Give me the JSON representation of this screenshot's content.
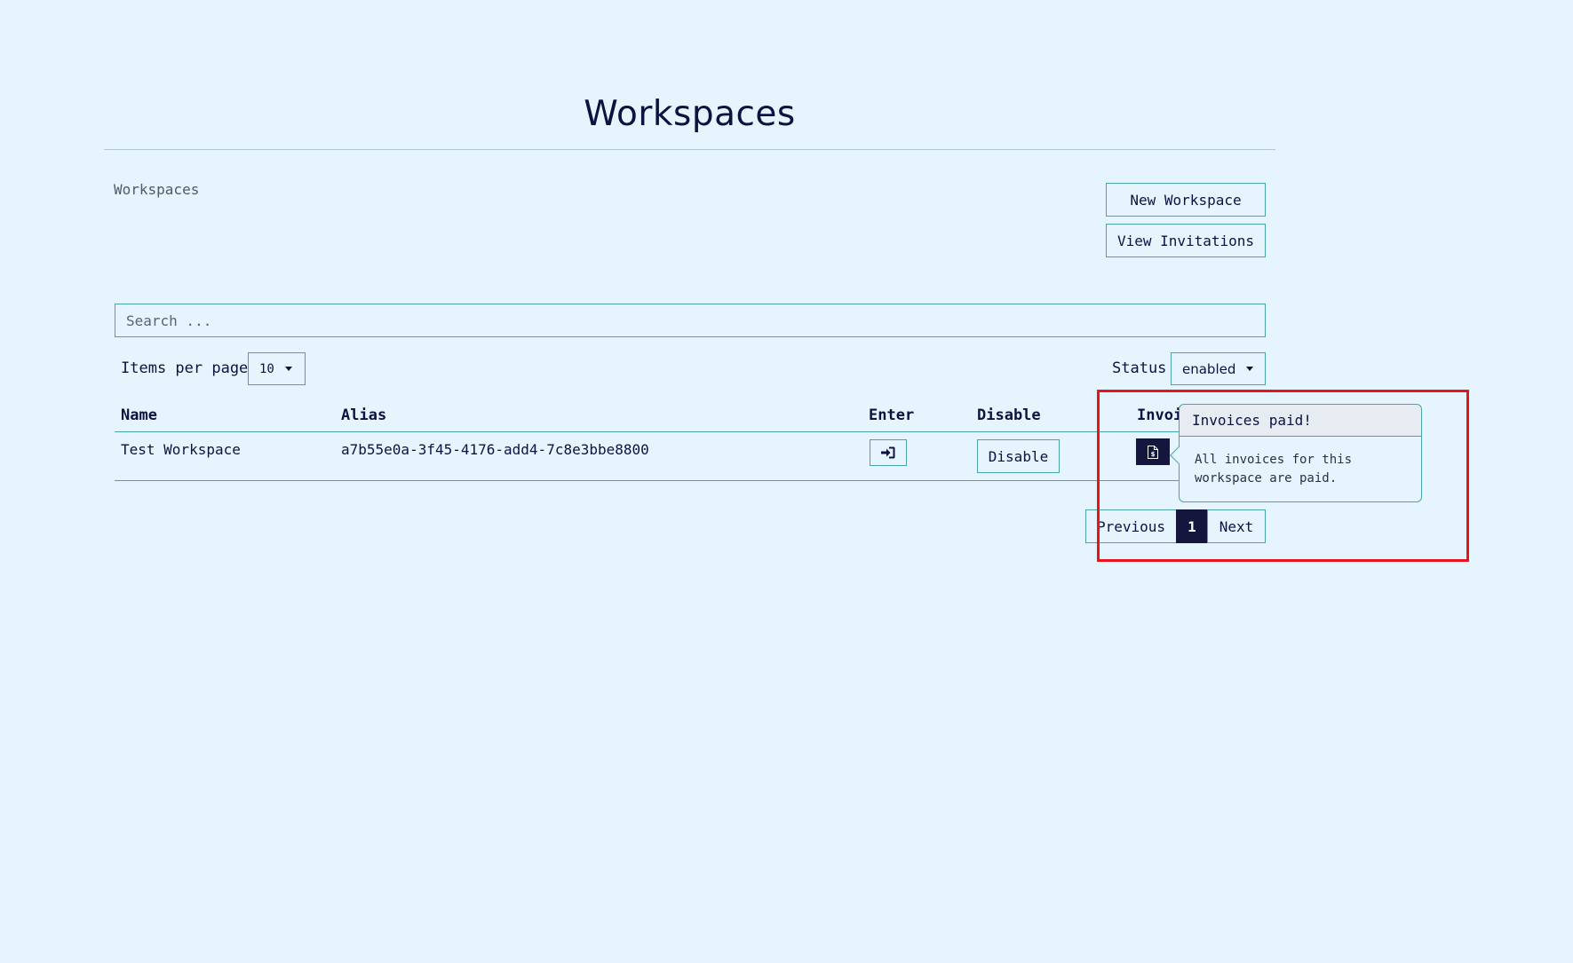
{
  "page": {
    "title": "Workspaces",
    "breadcrumb": "Workspaces"
  },
  "actions": {
    "new_workspace": "New Workspace",
    "view_invitations": "View Invitations"
  },
  "search": {
    "placeholder": "Search ...",
    "value": ""
  },
  "filters": {
    "items_per_page_label": "Items per page",
    "items_per_page_value": "10",
    "status_label": "Status",
    "status_value": "enabled"
  },
  "table": {
    "columns": [
      "Name",
      "Alias",
      "Enter",
      "Disable",
      "Invoices"
    ],
    "rows": [
      {
        "name": "Test Workspace",
        "alias": "a7b55e0a-3f45-4176-add4-7c8e3bbe8800",
        "enter_icon": "sign-in-icon",
        "disable_label": "Disable",
        "invoice_icon": "invoice-dollar-icon"
      }
    ]
  },
  "popover": {
    "title": "Invoices paid!",
    "body": "All invoices for this workspace are paid."
  },
  "pagination": {
    "previous": "Previous",
    "current": "1",
    "next": "Next"
  },
  "colors": {
    "background": "#e6f4fe",
    "border": "#4aa3a8",
    "text": "#0d1240",
    "active": "#14163e",
    "highlight": "#e8141c"
  }
}
